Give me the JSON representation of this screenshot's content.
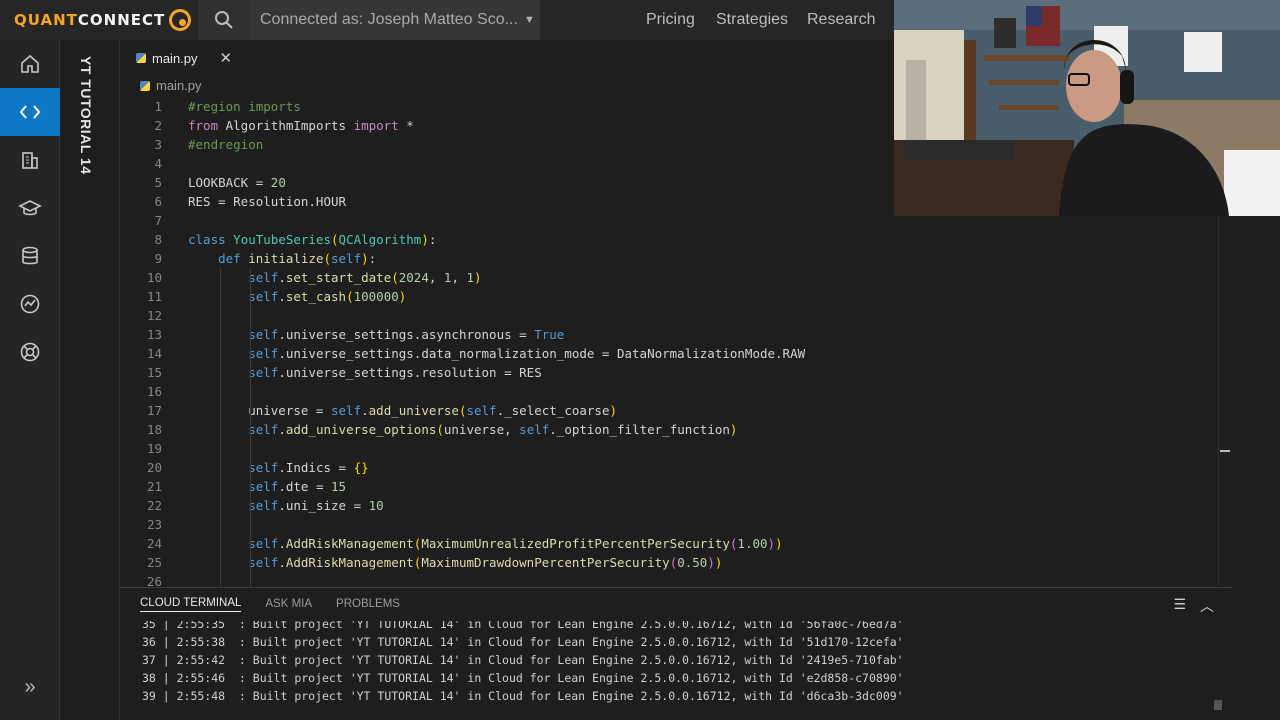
{
  "brand": {
    "quant": "QUANT",
    "connect": "CONNECT"
  },
  "account": {
    "label": "Connected as: Joseph Matteo Sco..."
  },
  "nav": {
    "pricing": "Pricing",
    "strategies": "Strategies",
    "research": "Research"
  },
  "project": {
    "name": "YT TUTORIAL 14"
  },
  "editor": {
    "tab_label": "main.py",
    "breadcrumb": "main.py",
    "line_numbers": [
      "1",
      "2",
      "3",
      "4",
      "5",
      "6",
      "7",
      "8",
      "9",
      "10",
      "11",
      "12",
      "13",
      "14",
      "15",
      "16",
      "17",
      "18",
      "19",
      "20",
      "21",
      "22",
      "23",
      "24",
      "25",
      "26"
    ]
  },
  "terminal": {
    "tabs": [
      "CLOUD TERMINAL",
      "ASK MIA",
      "PROBLEMS"
    ],
    "lines": [
      "35 | 2:55:35  : Built project 'YT TUTORIAL 14' in Cloud for Lean Engine 2.5.0.0.16712, with Id '56fa0c-76ed7a'",
      "36 | 2:55:38  : Built project 'YT TUTORIAL 14' in Cloud for Lean Engine 2.5.0.0.16712, with Id '51d170-12cefa'",
      "37 | 2:55:42  : Built project 'YT TUTORIAL 14' in Cloud for Lean Engine 2.5.0.0.16712, with Id '2419e5-710fab'",
      "38 | 2:55:46  : Built project 'YT TUTORIAL 14' in Cloud for Lean Engine 2.5.0.0.16712, with Id 'e2d858-c70890'",
      "39 | 2:55:48  : Built project 'YT TUTORIAL 14' in Cloud for Lean Engine 2.5.0.0.16712, with Id 'd6ca3b-3dc009'"
    ]
  },
  "colors": {
    "accent": "#0e78c6",
    "brand": "#f5a524"
  }
}
